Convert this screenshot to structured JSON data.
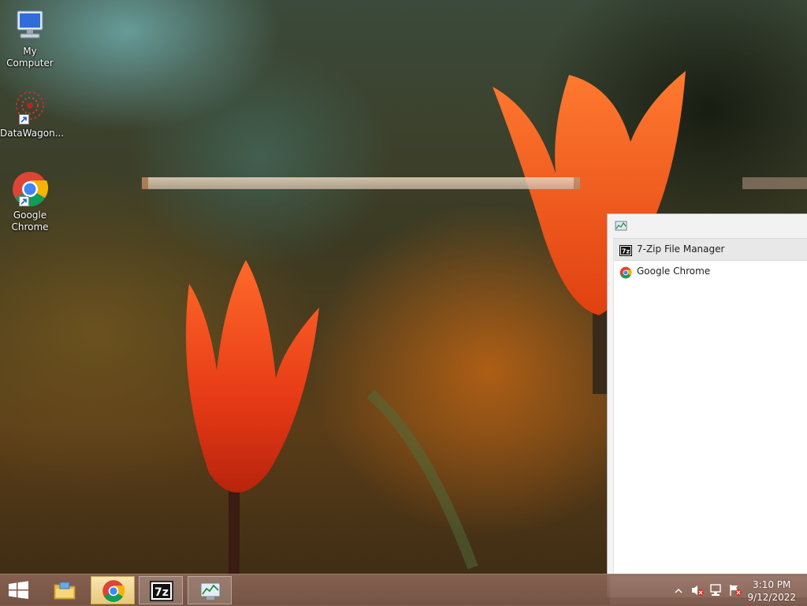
{
  "desktop": {
    "icons": [
      {
        "label": "My Computer"
      },
      {
        "label": "DataWagon..."
      },
      {
        "label": "Google Chrome"
      }
    ]
  },
  "jumplist": {
    "items": [
      {
        "label": "7-Zip File Manager"
      },
      {
        "label": "Google Chrome"
      }
    ]
  },
  "taskbar": {
    "buttons": [
      "start",
      "file-explorer",
      "google-chrome",
      "7-zip",
      "task-manager"
    ],
    "clock": {
      "time": "3:10 PM",
      "date": "9/12/2022"
    }
  },
  "colors": {
    "taskbar": "#8c6455",
    "active_button": "#e8c878",
    "panel_bg": "#ffffff"
  }
}
